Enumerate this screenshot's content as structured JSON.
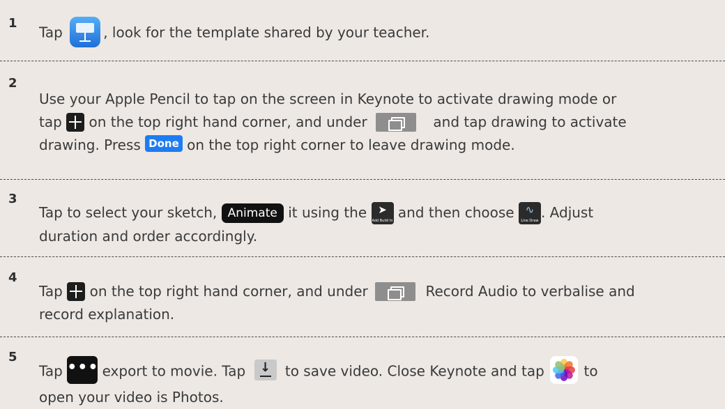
{
  "steps": [
    {
      "number": "1",
      "parts": {
        "a": "Tap",
        "b": ", look for the template shared by your teacher."
      }
    },
    {
      "number": "2",
      "parts": {
        "a": "Use your Apple Pencil to tap on the screen in Keynote to activate drawing mode or",
        "b": "tap",
        "c": "on the top right hand corner, and under",
        "d": "and tap drawing to activate",
        "e": "drawing. Press",
        "done_label": "Done",
        "f": "on the top right corner to leave drawing mode."
      }
    },
    {
      "number": "3",
      "parts": {
        "a": "Tap to select your sketch,",
        "animate_label": "Animate",
        "b": "it using the",
        "add_build_label": "Add Build In",
        "c": "and then choose",
        "line_draw_label": "Line Draw",
        "d": ". Adjust",
        "e": "duration and order accordingly."
      }
    },
    {
      "number": "4",
      "parts": {
        "a": "Tap",
        "b": "on the top right hand corner, and under",
        "c": "Record Audio to verbalise and",
        "d": "record explanation."
      }
    },
    {
      "number": "5",
      "parts": {
        "a": "Tap",
        "b": "export to movie. Tap",
        "c": "to save video. Close Keynote and tap",
        "d": "to",
        "e": "open your video is Photos."
      }
    }
  ],
  "icons": {
    "keynote": "keynote-app-icon",
    "plus": "plus-icon",
    "media": "media-icon",
    "add_build": "add-build-in-icon",
    "line_draw": "line-draw-icon",
    "more": "more-icon",
    "save": "save-download-icon",
    "photos": "photos-app-icon"
  },
  "colors": {
    "background": "#ede8e4",
    "text": "#3a3a3a",
    "done_blue": "#1e7cf2",
    "divider": "#4a4a4a"
  }
}
